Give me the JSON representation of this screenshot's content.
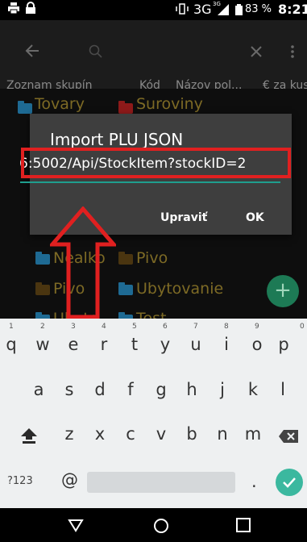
{
  "status_bar": {
    "network": "3G",
    "network_sup": "3G",
    "battery": "83 %",
    "time": "8:21"
  },
  "table_header": {
    "columns": [
      "Zoznam skupín",
      "Kód",
      "Názov pol...",
      "€ za kus"
    ]
  },
  "groups": {
    "row1": [
      "Tovary",
      "Suroviny"
    ],
    "row2": [
      "Nealko",
      "Pivo"
    ],
    "row3": [
      "Pivo",
      "Ubytovanie"
    ],
    "row4": [
      "Ubyto",
      "Test"
    ]
  },
  "dialog": {
    "title": "Import PLU JSON",
    "input_value": "6:5002/Api/StockItem?stockID=2",
    "edit_button": "Upraviť",
    "ok_button": "OK"
  },
  "fab": {
    "icon": "plus-icon",
    "label": "+"
  },
  "keyboard": {
    "row1": [
      {
        "k": "q",
        "n": "1"
      },
      {
        "k": "w",
        "n": "2"
      },
      {
        "k": "e",
        "n": "3"
      },
      {
        "k": "r",
        "n": "4"
      },
      {
        "k": "t",
        "n": "5"
      },
      {
        "k": "y",
        "n": "6"
      },
      {
        "k": "u",
        "n": "7"
      },
      {
        "k": "i",
        "n": "8"
      },
      {
        "k": "o",
        "n": "9"
      },
      {
        "k": "p",
        "n": "0"
      }
    ],
    "row2": [
      "a",
      "s",
      "d",
      "f",
      "g",
      "h",
      "j",
      "k",
      "l"
    ],
    "row3": [
      "z",
      "x",
      "c",
      "v",
      "b",
      "n",
      "m"
    ],
    "symbols_label": "?123",
    "at_key": "@",
    "period_key": "."
  },
  "colors": {
    "accent": "#1f9e8e",
    "annotation": "#e02020",
    "folder_blue": "#1e7fb0",
    "folder_red": "#b51d1d"
  }
}
